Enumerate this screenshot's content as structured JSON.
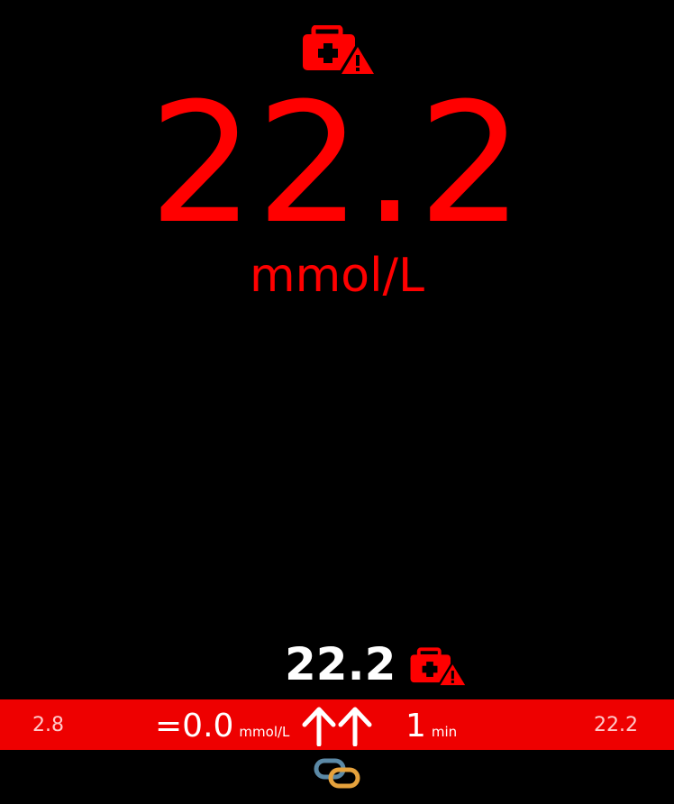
{
  "reading": {
    "value": "22.2",
    "unit": "mmol/L"
  },
  "mini_reading": {
    "value": "22.2"
  },
  "status_bar": {
    "range_low": "2.8",
    "range_high": "22.2",
    "delta_value": "=0.0",
    "delta_unit": "mmol/L",
    "trend_icon": "double-up-arrow-icon",
    "age_value": "1",
    "age_unit": "min"
  },
  "icons": {
    "alert": "first-aid-kit-warning-icon",
    "connection": "link-icon"
  },
  "colors": {
    "background": "#000000",
    "alert_red": "#ff0000",
    "status_bar_red": "#ee0000",
    "text_white": "#ffffff",
    "range_text": "#ffc9c9",
    "link_blue": "#5b89a6",
    "link_gold": "#e6a23c"
  }
}
